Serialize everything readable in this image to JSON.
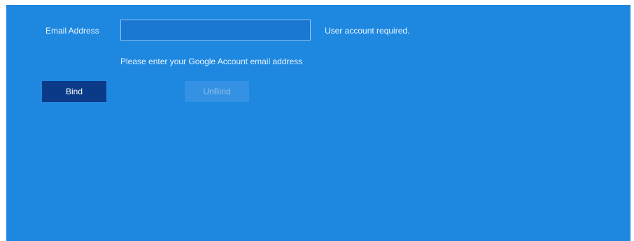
{
  "form": {
    "email_label": "Email Address",
    "email_value": "",
    "email_placeholder": "",
    "requirement_note": "User account required.",
    "hint": "Please enter your Google Account email address"
  },
  "buttons": {
    "bind_label": "Bind",
    "unbind_label": "UnBind",
    "unbind_enabled": false
  },
  "colors": {
    "panel_background": "#1e88e0",
    "bind_button": "#0a3a88",
    "unbind_button_disabled": "#3591e3"
  }
}
